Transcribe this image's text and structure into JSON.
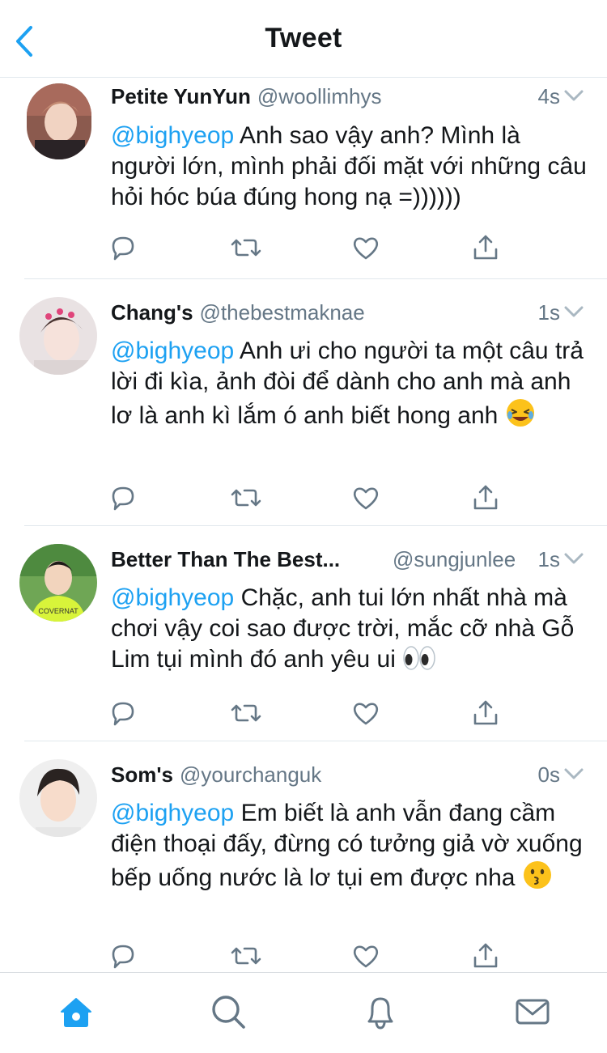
{
  "header": {
    "title": "Tweet",
    "back_icon": "chevron-left-icon"
  },
  "colors": {
    "accent": "#1da1f2",
    "text": "#14171a",
    "muted": "#657786",
    "divider": "#e1e8ed"
  },
  "tweets": [
    {
      "name": "Petite YunYun",
      "handle": "@woollimhys",
      "time": "4s",
      "mention": "@bighyeop",
      "text": " Anh sao vậy anh? Mình là người lớn, mình phải đối mặt với những câu hỏi hóc búa đúng hong nạ =))))))",
      "emoji": ""
    },
    {
      "name": "Chang's",
      "handle": "@thebestmaknae",
      "time": "1s",
      "mention": "@bighyeop",
      "text": " Anh ưi cho người ta một câu trả lời đi kìa, ảnh đòi để dành cho anh mà anh lơ là anh kì lắm ó anh biết hong anh ",
      "emoji": "rolling-laughing-emoji"
    },
    {
      "name": "Better Than The Best...",
      "handle": "@sungjunlee",
      "time": "1s",
      "mention": "@bighyeop",
      "text": " Chặc, anh tui lớn nhất nhà mà chơi vậy coi sao được trời, mắc cỡ nhà Gỗ Lim tụi mình đó anh yêu ui ",
      "emoji": "eyes-emoji"
    },
    {
      "name": "Som's",
      "handle": "@yourchanguk",
      "time": "0s",
      "mention": "@bighyeop",
      "text": " Em biết là anh vẫn đang cầm điện thoại đấy, đừng có tưởng giả vờ xuống bếp uống nước là lơ tụi em được nha ",
      "emoji": "kissing-face-emoji"
    }
  ],
  "actions": [
    "reply-icon",
    "retweet-icon",
    "like-icon",
    "share-icon"
  ],
  "tabbar": [
    "home-icon",
    "search-icon",
    "notifications-icon",
    "messages-icon"
  ]
}
